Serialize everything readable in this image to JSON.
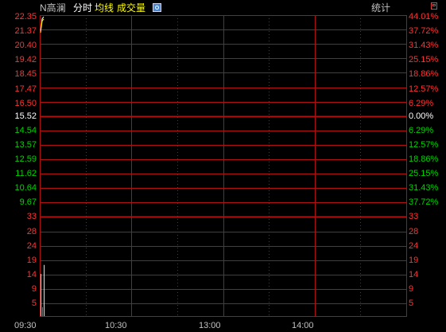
{
  "header": {
    "stock_name": "N高澜",
    "tab_fenshi": "分时",
    "tab_junxian": "均线",
    "tab_volume": "成交量",
    "settings_icon": "settings-icon",
    "stats_label": "统计",
    "maximize_icon": "maximize-icon"
  },
  "colors": {
    "background": "#000000",
    "grid": "#b01010",
    "up": "#ff3232",
    "down": "#00d200",
    "neutral": "#ffffff",
    "axis_text": "#c0c0c0",
    "price_line": "#ffffff",
    "avg_line": "#ffff00"
  },
  "price_axis": {
    "up_prices": [
      "22.35",
      "21.37",
      "20.40",
      "19.42",
      "18.45",
      "17.47",
      "16.50"
    ],
    "base_price": "15.52",
    "down_prices": [
      "14.54",
      "13.57",
      "12.59",
      "11.62",
      "10.64",
      "9.67"
    ],
    "up_pcts": [
      "44.01%",
      "37.72%",
      "31.43%",
      "25.15%",
      "18.86%",
      "12.57%",
      "6.29%"
    ],
    "base_pct": "0.00%",
    "down_pcts": [
      "6.29%",
      "12.57%",
      "18.86%",
      "25.15%",
      "31.43%",
      "37.72%"
    ]
  },
  "volume_axis": {
    "left": [
      "33",
      "28",
      "24",
      "19",
      "14",
      "9",
      "5"
    ],
    "right": [
      "33",
      "28",
      "24",
      "19",
      "14",
      "9",
      "5"
    ]
  },
  "time_axis": [
    "09:30",
    "10:30",
    "13:00",
    "14:00"
  ],
  "chart_data": {
    "type": "line",
    "price_series": {
      "name": "",
      "x": [
        "09:30",
        "09:31",
        "09:32"
      ],
      "values": [
        21.4,
        22.2,
        22.35
      ]
    },
    "volume_series": {
      "name": "",
      "x": [
        "09:30",
        "09:31",
        "09:32"
      ],
      "values": [
        14,
        3,
        17
      ]
    },
    "price_range": [
      9.67,
      22.35
    ],
    "volume_range": [
      0,
      33
    ],
    "grid": true
  }
}
